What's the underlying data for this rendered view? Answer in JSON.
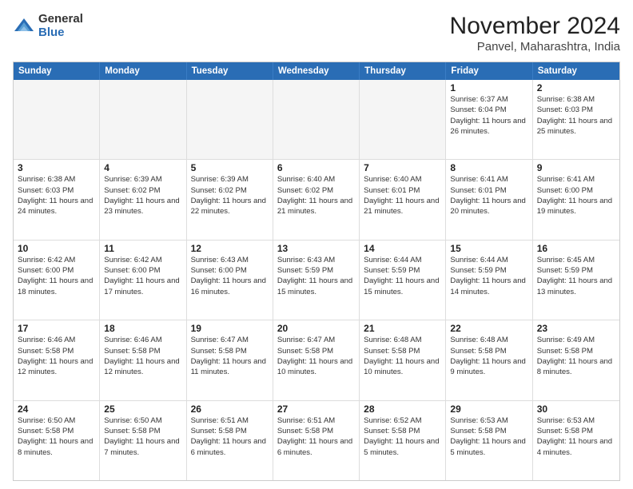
{
  "logo": {
    "general": "General",
    "blue": "Blue"
  },
  "header": {
    "title": "November 2024",
    "subtitle": "Panvel, Maharashtra, India"
  },
  "calendar": {
    "days_of_week": [
      "Sunday",
      "Monday",
      "Tuesday",
      "Wednesday",
      "Thursday",
      "Friday",
      "Saturday"
    ],
    "rows": [
      [
        {
          "day": "",
          "empty": true
        },
        {
          "day": "",
          "empty": true
        },
        {
          "day": "",
          "empty": true
        },
        {
          "day": "",
          "empty": true
        },
        {
          "day": "",
          "empty": true
        },
        {
          "day": "1",
          "sunrise": "Sunrise: 6:37 AM",
          "sunset": "Sunset: 6:04 PM",
          "daylight": "Daylight: 11 hours and 26 minutes."
        },
        {
          "day": "2",
          "sunrise": "Sunrise: 6:38 AM",
          "sunset": "Sunset: 6:03 PM",
          "daylight": "Daylight: 11 hours and 25 minutes."
        }
      ],
      [
        {
          "day": "3",
          "sunrise": "Sunrise: 6:38 AM",
          "sunset": "Sunset: 6:03 PM",
          "daylight": "Daylight: 11 hours and 24 minutes."
        },
        {
          "day": "4",
          "sunrise": "Sunrise: 6:39 AM",
          "sunset": "Sunset: 6:02 PM",
          "daylight": "Daylight: 11 hours and 23 minutes."
        },
        {
          "day": "5",
          "sunrise": "Sunrise: 6:39 AM",
          "sunset": "Sunset: 6:02 PM",
          "daylight": "Daylight: 11 hours and 22 minutes."
        },
        {
          "day": "6",
          "sunrise": "Sunrise: 6:40 AM",
          "sunset": "Sunset: 6:02 PM",
          "daylight": "Daylight: 11 hours and 21 minutes."
        },
        {
          "day": "7",
          "sunrise": "Sunrise: 6:40 AM",
          "sunset": "Sunset: 6:01 PM",
          "daylight": "Daylight: 11 hours and 21 minutes."
        },
        {
          "day": "8",
          "sunrise": "Sunrise: 6:41 AM",
          "sunset": "Sunset: 6:01 PM",
          "daylight": "Daylight: 11 hours and 20 minutes."
        },
        {
          "day": "9",
          "sunrise": "Sunrise: 6:41 AM",
          "sunset": "Sunset: 6:00 PM",
          "daylight": "Daylight: 11 hours and 19 minutes."
        }
      ],
      [
        {
          "day": "10",
          "sunrise": "Sunrise: 6:42 AM",
          "sunset": "Sunset: 6:00 PM",
          "daylight": "Daylight: 11 hours and 18 minutes."
        },
        {
          "day": "11",
          "sunrise": "Sunrise: 6:42 AM",
          "sunset": "Sunset: 6:00 PM",
          "daylight": "Daylight: 11 hours and 17 minutes."
        },
        {
          "day": "12",
          "sunrise": "Sunrise: 6:43 AM",
          "sunset": "Sunset: 6:00 PM",
          "daylight": "Daylight: 11 hours and 16 minutes."
        },
        {
          "day": "13",
          "sunrise": "Sunrise: 6:43 AM",
          "sunset": "Sunset: 5:59 PM",
          "daylight": "Daylight: 11 hours and 15 minutes."
        },
        {
          "day": "14",
          "sunrise": "Sunrise: 6:44 AM",
          "sunset": "Sunset: 5:59 PM",
          "daylight": "Daylight: 11 hours and 15 minutes."
        },
        {
          "day": "15",
          "sunrise": "Sunrise: 6:44 AM",
          "sunset": "Sunset: 5:59 PM",
          "daylight": "Daylight: 11 hours and 14 minutes."
        },
        {
          "day": "16",
          "sunrise": "Sunrise: 6:45 AM",
          "sunset": "Sunset: 5:59 PM",
          "daylight": "Daylight: 11 hours and 13 minutes."
        }
      ],
      [
        {
          "day": "17",
          "sunrise": "Sunrise: 6:46 AM",
          "sunset": "Sunset: 5:58 PM",
          "daylight": "Daylight: 11 hours and 12 minutes."
        },
        {
          "day": "18",
          "sunrise": "Sunrise: 6:46 AM",
          "sunset": "Sunset: 5:58 PM",
          "daylight": "Daylight: 11 hours and 12 minutes."
        },
        {
          "day": "19",
          "sunrise": "Sunrise: 6:47 AM",
          "sunset": "Sunset: 5:58 PM",
          "daylight": "Daylight: 11 hours and 11 minutes."
        },
        {
          "day": "20",
          "sunrise": "Sunrise: 6:47 AM",
          "sunset": "Sunset: 5:58 PM",
          "daylight": "Daylight: 11 hours and 10 minutes."
        },
        {
          "day": "21",
          "sunrise": "Sunrise: 6:48 AM",
          "sunset": "Sunset: 5:58 PM",
          "daylight": "Daylight: 11 hours and 10 minutes."
        },
        {
          "day": "22",
          "sunrise": "Sunrise: 6:48 AM",
          "sunset": "Sunset: 5:58 PM",
          "daylight": "Daylight: 11 hours and 9 minutes."
        },
        {
          "day": "23",
          "sunrise": "Sunrise: 6:49 AM",
          "sunset": "Sunset: 5:58 PM",
          "daylight": "Daylight: 11 hours and 8 minutes."
        }
      ],
      [
        {
          "day": "24",
          "sunrise": "Sunrise: 6:50 AM",
          "sunset": "Sunset: 5:58 PM",
          "daylight": "Daylight: 11 hours and 8 minutes."
        },
        {
          "day": "25",
          "sunrise": "Sunrise: 6:50 AM",
          "sunset": "Sunset: 5:58 PM",
          "daylight": "Daylight: 11 hours and 7 minutes."
        },
        {
          "day": "26",
          "sunrise": "Sunrise: 6:51 AM",
          "sunset": "Sunset: 5:58 PM",
          "daylight": "Daylight: 11 hours and 6 minutes."
        },
        {
          "day": "27",
          "sunrise": "Sunrise: 6:51 AM",
          "sunset": "Sunset: 5:58 PM",
          "daylight": "Daylight: 11 hours and 6 minutes."
        },
        {
          "day": "28",
          "sunrise": "Sunrise: 6:52 AM",
          "sunset": "Sunset: 5:58 PM",
          "daylight": "Daylight: 11 hours and 5 minutes."
        },
        {
          "day": "29",
          "sunrise": "Sunrise: 6:53 AM",
          "sunset": "Sunset: 5:58 PM",
          "daylight": "Daylight: 11 hours and 5 minutes."
        },
        {
          "day": "30",
          "sunrise": "Sunrise: 6:53 AM",
          "sunset": "Sunset: 5:58 PM",
          "daylight": "Daylight: 11 hours and 4 minutes."
        }
      ]
    ]
  }
}
